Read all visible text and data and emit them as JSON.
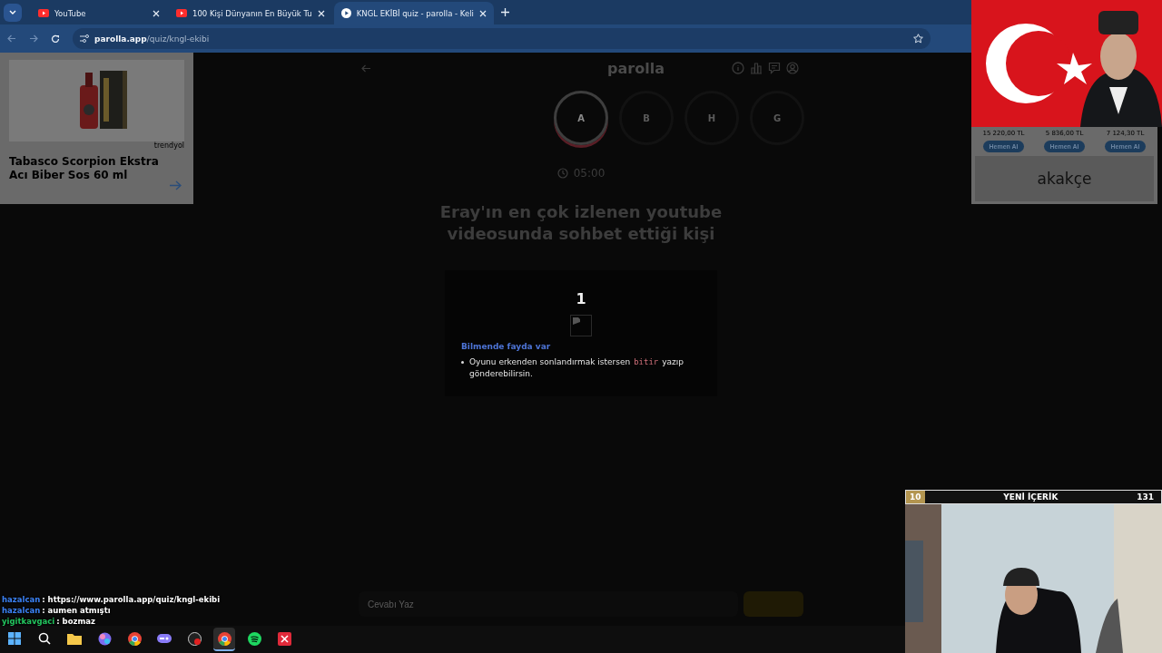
{
  "browser": {
    "tabs": [
      {
        "title": "YouTube",
        "kind": "youtube",
        "selected": false
      },
      {
        "title": "100 Kişi Dünyanın En Büyük Tu",
        "kind": "youtube",
        "selected": false
      },
      {
        "title": "KNGL EKİBİ quiz - parolla - Keli",
        "kind": "parolla",
        "selected": true
      }
    ],
    "address": {
      "domain": "parolla.app",
      "path": "/quiz/kngl-ekibi"
    }
  },
  "ad_left": {
    "store": "trendyol",
    "title": "Tabasco Scorpion Ekstra Acı Biber Sos 60 ml"
  },
  "quiz": {
    "logo": "parolla",
    "letters": [
      {
        "letter": "A",
        "selected": true
      },
      {
        "letter": "B",
        "selected": false
      },
      {
        "letter": "H",
        "selected": false
      },
      {
        "letter": "G",
        "selected": false
      }
    ],
    "timer": "05:00",
    "question": "Eray'ın en çok izlenen youtube videosunda sohbet ettiği kişi",
    "card": {
      "number": "1",
      "tip_title": "Bilmende fayda var",
      "tip_before": "Oyunu erkenden sonlandırmak istersen",
      "tip_code": "bitir",
      "tip_after": "yazıp gönderebilirsin."
    },
    "answer": {
      "placeholder": "Cevabı Yaz"
    }
  },
  "ad_right": {
    "products": [
      {
        "price": "15 220,00 TL",
        "button": "Hemen Al"
      },
      {
        "price": "5 836,00 TL",
        "button": "Hemen Al"
      },
      {
        "price": "7 124,30 TL",
        "button": "Hemen Al"
      }
    ],
    "brand": "akakçe"
  },
  "stream": {
    "badge": "10",
    "title": "YENİ İÇERİK",
    "count": "131",
    "chat": [
      {
        "user": "hazalcan",
        "message": ": https://www.parolla.app/quiz/kngl-ekibi",
        "color": "#3b82f6"
      },
      {
        "user": "hazalcan",
        "message": ": aumen atmıştı",
        "color": "#3b82f6"
      },
      {
        "user": "yigitkavgaci",
        "message": ": bozmaz",
        "color": "#22c55e"
      }
    ]
  },
  "taskbar": {
    "apps": [
      {
        "kind": "windows",
        "selected": false
      },
      {
        "kind": "search",
        "selected": false
      },
      {
        "kind": "folder",
        "selected": false
      },
      {
        "kind": "copilot",
        "selected": false
      },
      {
        "kind": "chrome",
        "selected": false
      },
      {
        "kind": "gamepad",
        "selected": false
      },
      {
        "kind": "obs",
        "selected": false
      },
      {
        "kind": "chrome",
        "selected": true
      },
      {
        "kind": "spotify",
        "selected": false
      },
      {
        "kind": "xapp",
        "selected": false
      }
    ]
  }
}
